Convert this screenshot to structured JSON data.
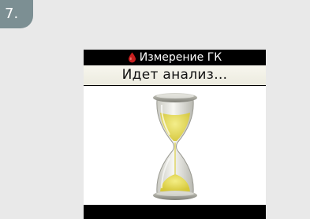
{
  "step": {
    "number": "7."
  },
  "screen": {
    "title": "Измерение ГК",
    "status": "Идет анализ…",
    "icons": {
      "title_icon": "blood-drop-icon",
      "progress_icon": "hourglass-icon"
    }
  },
  "colors": {
    "badge": "#7c8f93",
    "panel_background": "#e9e9e9",
    "drop": "#c8201f",
    "sand": "#e6d94f"
  }
}
